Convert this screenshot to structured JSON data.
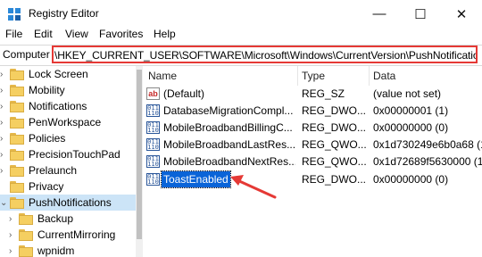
{
  "window": {
    "title": "Registry Editor",
    "minimize": "—",
    "maximize": "☐",
    "close": "✕"
  },
  "menu": [
    "File",
    "Edit",
    "View",
    "Favorites",
    "Help"
  ],
  "address": {
    "label": "Computer",
    "path": "\\HKEY_CURRENT_USER\\SOFTWARE\\Microsoft\\Windows\\CurrentVersion\\PushNotifications"
  },
  "tree": [
    {
      "label": "Lock Screen",
      "expander": "›"
    },
    {
      "label": "Mobility",
      "expander": "›"
    },
    {
      "label": "Notifications",
      "expander": "›"
    },
    {
      "label": "PenWorkspace",
      "expander": "›"
    },
    {
      "label": "Policies",
      "expander": "›"
    },
    {
      "label": "PrecisionTouchPad",
      "expander": "›"
    },
    {
      "label": "Prelaunch",
      "expander": "›"
    },
    {
      "label": "Privacy",
      "expander": ""
    },
    {
      "label": "PushNotifications",
      "expander": "⌄",
      "selected": true
    },
    {
      "label": "Backup",
      "expander": "›"
    },
    {
      "label": "CurrentMirroring",
      "expander": "›"
    },
    {
      "label": "wpnidm",
      "expander": "›"
    }
  ],
  "columns": {
    "name": "Name",
    "type": "Type",
    "data": "Data"
  },
  "values": [
    {
      "icon": "string-value-icon",
      "name": "(Default)",
      "type": "REG_SZ",
      "data": "(value not set)"
    },
    {
      "icon": "binary-value-icon",
      "name": "DatabaseMigrationCompl...",
      "type": "REG_DWO...",
      "data": "0x00000001 (1)"
    },
    {
      "icon": "binary-value-icon",
      "name": "MobileBroadbandBillingC...",
      "type": "REG_DWO...",
      "data": "0x00000000 (0)"
    },
    {
      "icon": "binary-value-icon",
      "name": "MobileBroadbandLastRes...",
      "type": "REG_QWO...",
      "data": "0x1d730249e6b0a68 (13"
    },
    {
      "icon": "binary-value-icon",
      "name": "MobileBroadbandNextRes...",
      "type": "REG_QWO...",
      "data": "0x1d72689f5630000 (13"
    },
    {
      "icon": "binary-value-icon",
      "name": "ToastEnabled",
      "type": "REG_DWO...",
      "data": "0x00000000 (0)",
      "selected": true
    }
  ],
  "colors": {
    "highlight": "#e53935",
    "selection": "#0a64d8",
    "folder": "#f5cf61"
  }
}
